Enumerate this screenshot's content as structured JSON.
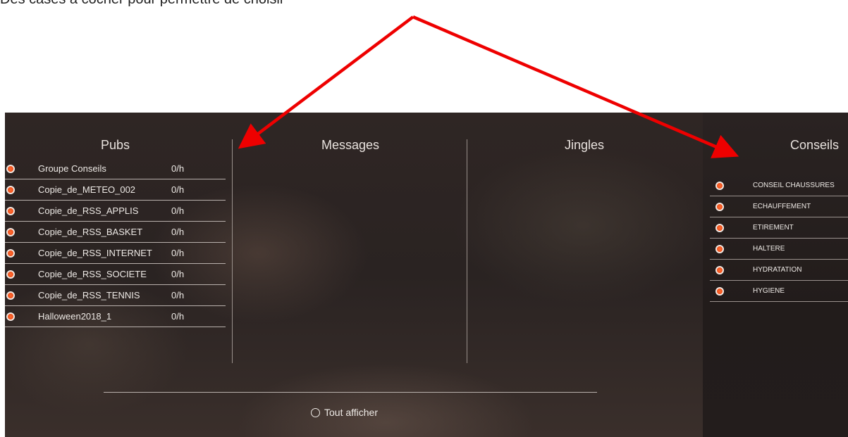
{
  "top_fragment": {
    "text": "Des cases à cocher pour permettre de choisir"
  },
  "columns": {
    "pubs_title": "Pubs",
    "messages_title": "Messages",
    "jingles_title": "Jingles",
    "conseils_title": "Conseils"
  },
  "pubs": [
    {
      "name": "Groupe Conseils",
      "rate": "0/h"
    },
    {
      "name": "Copie_de_METEO_002",
      "rate": "0/h"
    },
    {
      "name": "Copie_de_RSS_APPLIS",
      "rate": "0/h"
    },
    {
      "name": "Copie_de_RSS_BASKET",
      "rate": "0/h"
    },
    {
      "name": "Copie_de_RSS_INTERNET",
      "rate": "0/h"
    },
    {
      "name": "Copie_de_RSS_SOCIETE",
      "rate": "0/h"
    },
    {
      "name": "Copie_de_RSS_TENNIS",
      "rate": "0/h"
    },
    {
      "name": "Halloween2018_1",
      "rate": "0/h"
    }
  ],
  "conseils": [
    {
      "name": "CONSEIL CHAUSSURES"
    },
    {
      "name": "ECHAUFFEMENT"
    },
    {
      "name": "ETIREMENT"
    },
    {
      "name": "HALTERE"
    },
    {
      "name": "HYDRATATION"
    },
    {
      "name": "HYGIENE"
    }
  ],
  "show_all_label": "Tout afficher",
  "colors": {
    "radio_accent": "#f2551d",
    "annotation_arrow": "#ee0000",
    "panel_background": "#2b2423"
  }
}
